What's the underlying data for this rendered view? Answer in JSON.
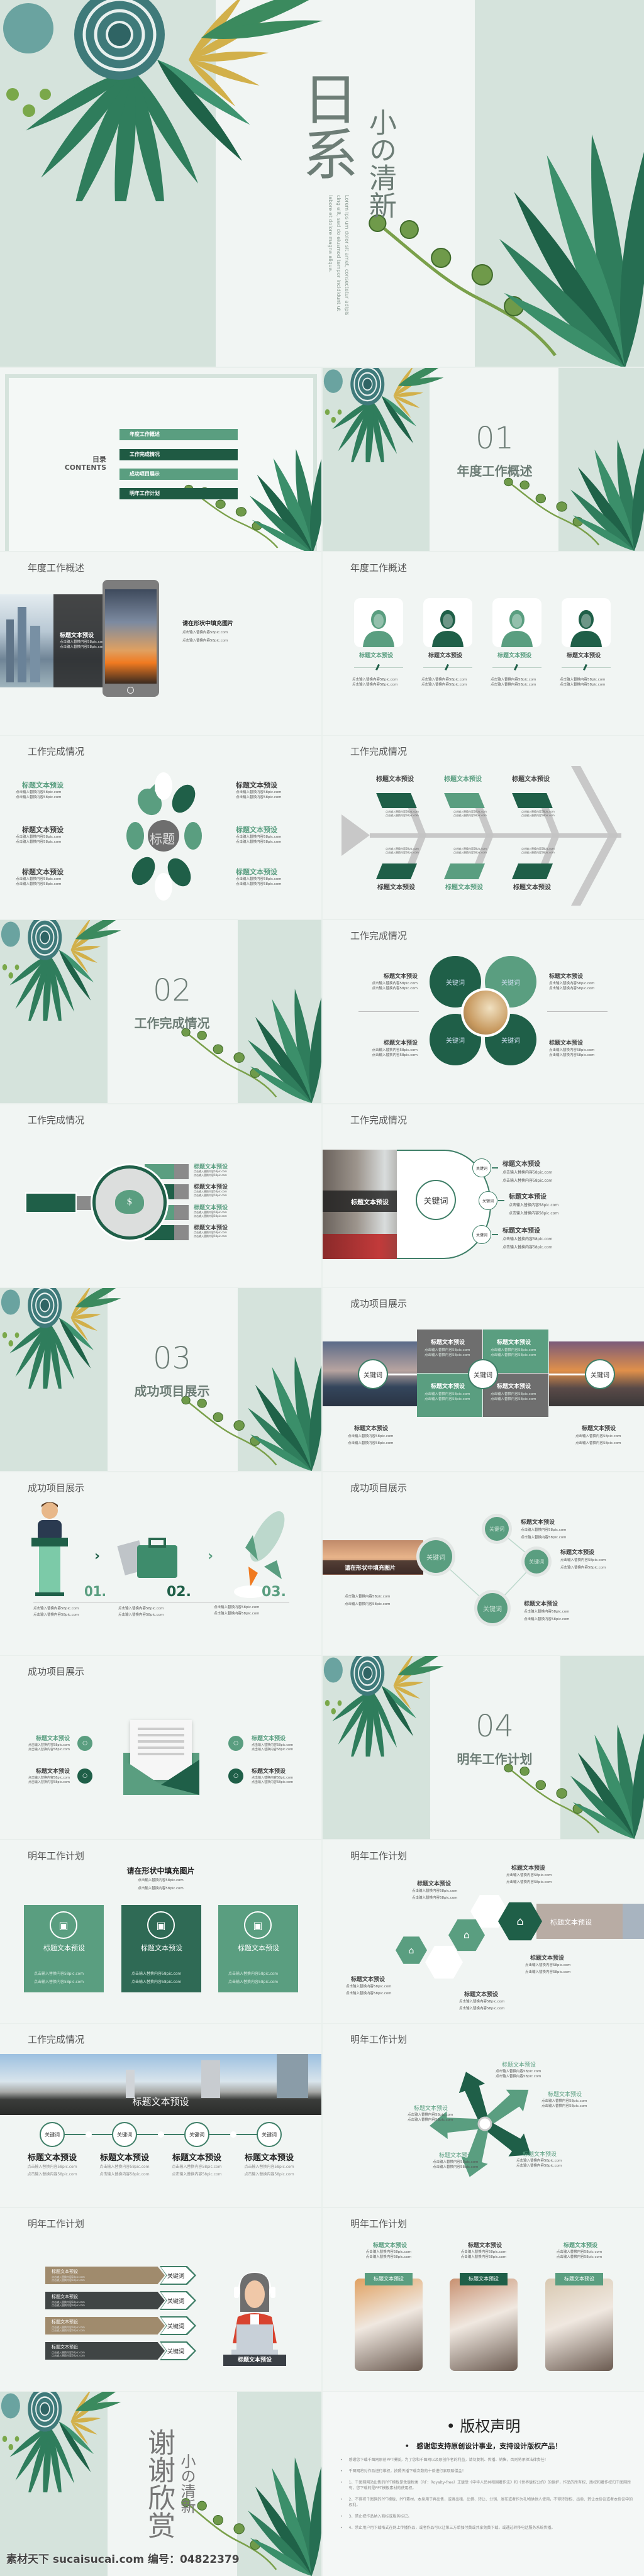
{
  "cover": {
    "title_main": "日系",
    "title_sub": "小の清新",
    "lorem": "Lorem ips um dolor sit amet, consectetur adipis cing elit, sed do eiusmod tempor incididunt ut labore et dolore magna aliqua."
  },
  "common": {
    "heading": "标题文本预设",
    "body": "点击输入替换内容58pic.com",
    "keyword": "关键词",
    "fill_image": "请在形状中填充图片",
    "hub": "标题"
  },
  "contents": {
    "label_cn": "目录",
    "label_en": "CONTENTS",
    "items": [
      "年度工作概述",
      "工作完成情况",
      "成功项目展示",
      "明年工作计划"
    ]
  },
  "sections": [
    {
      "number": "01",
      "title": "年度工作概述"
    },
    {
      "number": "02",
      "title": "工作完成情况"
    },
    {
      "number": "03",
      "title": "成功项目展示"
    },
    {
      "number": "04",
      "title": "明年工作计划"
    }
  ],
  "slide_titles": {
    "overview": "年度工作概述",
    "completion": "工作完成情况",
    "projects": "成功项目展示",
    "plan": "明年工作计划"
  },
  "steps": [
    "01.",
    "02.",
    "03."
  ],
  "thanks": {
    "title": "谢谢欣赏",
    "sub": "小の清新"
  },
  "copyright": {
    "title": "版权声明",
    "subtitle": "感谢您支持原创设计事业，支持设计版权产品！",
    "items": [
      "感谢您下载千图网原创PPT模板，为了您和千图网以及原创作者的利益，请勿复制、传播、销售，否则将承担法律责任！",
      "千图网将对作品进行维权，按照传播下载次数的十倍进行索取赔偿金！",
      "1、千图网网站出售的PPT模板是免版税类（RF：Royalty-free）正版受《中华人民共和国著作法》和《世界版权公约》的保护，作品的所有权、版权和著作权归千图网所有，您下载的是PPT模板素材的使用权。",
      "2、不得将千图网的PPT模板、PPT素材，本身用于再出售，或者出租、出借、转让、分销、发布或者作为礼物供他人使用，不得转授权、出卖、转让本协议或者本协议中的权利。",
      "3、禁止把作品纳入商标或服务标记。",
      "4、禁止用户用下载格式在网上传播作品，或者作品可以让第三方单独付费或共享免费下载，或通过转移电话服务系统传播。"
    ]
  },
  "watermark": "素材天下 sucaisucai.com  编号：04822379",
  "colors": {
    "background": "#f1f5f3",
    "panel": "#d5e3dc",
    "dark_green": "#1f5f48",
    "mid_green": "#5a9e80",
    "text_gray": "#6d7d76",
    "tan": "#a08b6d"
  }
}
